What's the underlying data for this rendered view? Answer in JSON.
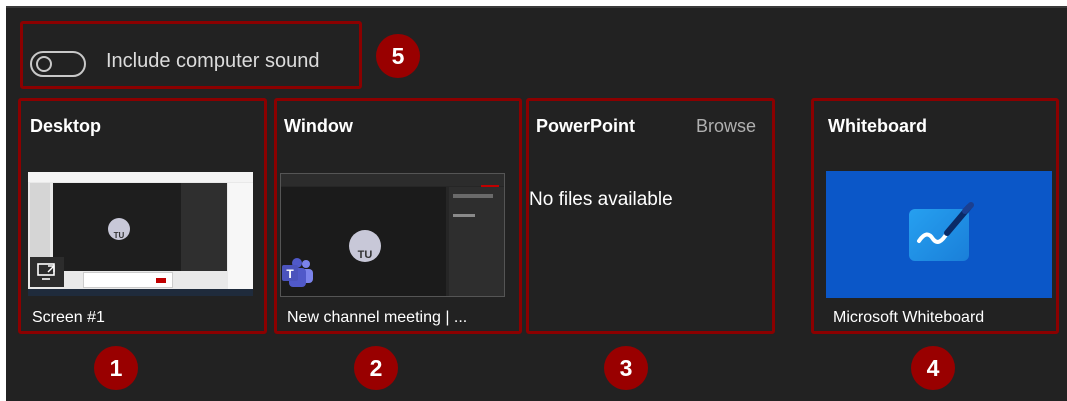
{
  "sound_toggle": {
    "label": "Include computer sound",
    "state": "off"
  },
  "sections": {
    "desktop": {
      "title": "Desktop",
      "caption": "Screen #1"
    },
    "window": {
      "title": "Window",
      "caption": "New channel meeting | ..."
    },
    "powerpoint": {
      "title": "PowerPoint",
      "browse_label": "Browse",
      "empty_text": "No files available"
    },
    "whiteboard": {
      "title": "Whiteboard",
      "caption": "Microsoft Whiteboard"
    }
  },
  "thumbnail_text": {
    "desktop_avatar": "TU",
    "window_avatar": "TU"
  },
  "callouts": [
    "1",
    "2",
    "3",
    "4",
    "5"
  ],
  "colors": {
    "panel_bg": "#222222",
    "callout_border": "#8b0000",
    "callout_badge": "#990000",
    "whiteboard_tile": "#0b57c8"
  },
  "icons": {
    "desktop": "screen-share-icon",
    "window": "teams-icon",
    "whiteboard": "whiteboard-pen-icon"
  }
}
